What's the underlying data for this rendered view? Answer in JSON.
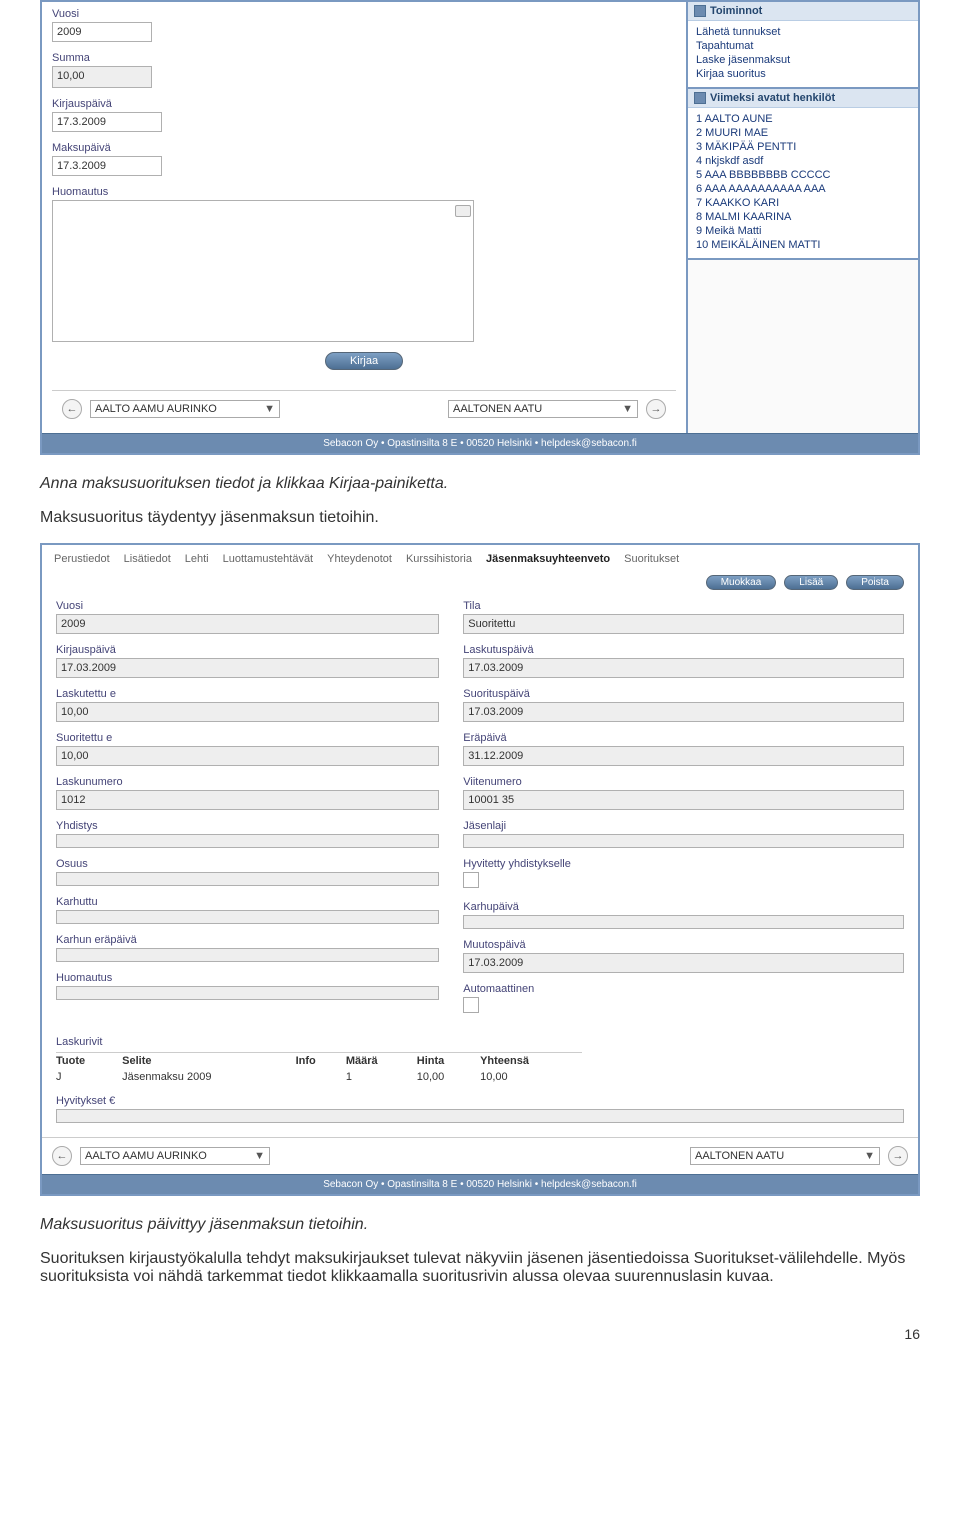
{
  "frame1": {
    "fields": {
      "vuosi_label": "Vuosi",
      "vuosi_value": "2009",
      "summa_label": "Summa",
      "summa_value": "10,00",
      "kirjauspaiva_label": "Kirjauspäivä",
      "kirjauspaiva_value": "17.3.2009",
      "maksupaiva_label": "Maksupäivä",
      "maksupaiva_value": "17.3.2009",
      "huomautus_label": "Huomautus"
    },
    "kirjaa_btn": "Kirjaa",
    "nav": {
      "left_name": "AALTO AAMU AURINKO",
      "right_name": "AALTONEN AATU"
    },
    "sidebar": {
      "toiminnot_title": "Toiminnot",
      "toiminnot_items": [
        "Lähetä tunnukset",
        "Tapahtumat",
        "Laske jäsenmaksut",
        "Kirjaa suoritus"
      ],
      "viimeksi_title": "Viimeksi avatut henkilöt",
      "viimeksi_items": [
        "1 AALTO AUNE",
        "2 MUURI MAE",
        "3 MÄKIPÄÄ PENTTI",
        "4 nkjskdf asdf",
        "5 AAA BBBBBBBB CCCCC",
        "6 AAA AAAAAAAAAA AAA",
        "7 KAAKKO KARI",
        "8 MALMI KAARINA",
        "9 Meikä Matti",
        "10 MEIKÄLÄINEN MATTI"
      ]
    }
  },
  "footer_text": "Sebacon Oy • Opastinsilta 8 E • 00520 Helsinki • helpdesk@sebacon.fi",
  "doc": {
    "p1": "Anna maksusuorituksen tiedot ja klikkaa Kirjaa-painiketta.",
    "p2": "Maksusuoritus täydentyy jäsenmaksun tietoihin.",
    "p3": "Maksusuoritus päivittyy jäsenmaksun tietoihin.",
    "p4": "Suorituksen kirjaustyökalulla tehdyt maksukirjaukset tulevat näkyviin jäsenen jäsentiedoissa Suoritukset-välilehdelle. Myös suorituksista voi nähdä tarkemmat tiedot klikkaamalla suoritusrivin alussa olevaa suurennuslasin kuvaa.",
    "page_num": "16"
  },
  "frame2": {
    "tabs": [
      "Perustiedot",
      "Lisätiedot",
      "Lehti",
      "Luottamustehtävät",
      "Yhteydenotot",
      "Kurssihistoria",
      "Jäsenmaksuyhteenveto",
      "Suoritukset"
    ],
    "active_tab_index": 6,
    "actions": {
      "edit": "Muokkaa",
      "add": "Lisää",
      "del": "Poista"
    },
    "left": {
      "vuosi_label": "Vuosi",
      "vuosi_value": "2009",
      "kirjauspaiva_label": "Kirjauspäivä",
      "kirjauspaiva_value": "17.03.2009",
      "laskutettu_label": "Laskutettu e",
      "laskutettu_value": "10,00",
      "suoritettu_label": "Suoritettu e",
      "suoritettu_value": "10,00",
      "laskunumero_label": "Laskunumero",
      "laskunumero_value": "1012",
      "yhdistys_label": "Yhdistys",
      "yhdistys_value": "",
      "osuus_label": "Osuus",
      "osuus_value": "",
      "karhuttu_label": "Karhuttu",
      "karhuttu_value": "",
      "karhun_erapaiva_label": "Karhun eräpäivä",
      "karhun_erapaiva_value": "",
      "huomautus_label": "Huomautus",
      "huomautus_value": ""
    },
    "right": {
      "tila_label": "Tila",
      "tila_value": "Suoritettu",
      "laskutuspaiva_label": "Laskutuspäivä",
      "laskutuspaiva_value": "17.03.2009",
      "suorituspaiva_label": "Suorituspäivä",
      "suorituspaiva_value": "17.03.2009",
      "erapaiva_label": "Eräpäivä",
      "erapaiva_value": "31.12.2009",
      "viitenumero_label": "Viitenumero",
      "viitenumero_value": "10001 35",
      "jasenlaji_label": "Jäsenlaji",
      "jasenlaji_value": "",
      "hyvitetty_label": "Hyvitetty yhdistykselle",
      "karhupaiva_label": "Karhupäivä",
      "karhupaiva_value": "",
      "muutospaiva_label": "Muutospäivä",
      "muutospaiva_value": "17.03.2009",
      "automaattinen_label": "Automaattinen"
    },
    "laskurivit_label": "Laskurivit",
    "table": {
      "h_tuote": "Tuote",
      "h_selite": "Selite",
      "h_info": "Info",
      "h_maara": "Määrä",
      "h_hinta": "Hinta",
      "h_yhteensa": "Yhteensä",
      "r_tuote": "J",
      "r_selite": "Jäsenmaksu 2009",
      "r_info": "",
      "r_maara": "1",
      "r_hinta": "10,00",
      "r_yhteensa": "10,00"
    },
    "hyvitykset_label": "Hyvitykset €",
    "nav": {
      "left_name": "AALTO AAMU AURINKO",
      "right_name": "AALTONEN AATU"
    }
  }
}
